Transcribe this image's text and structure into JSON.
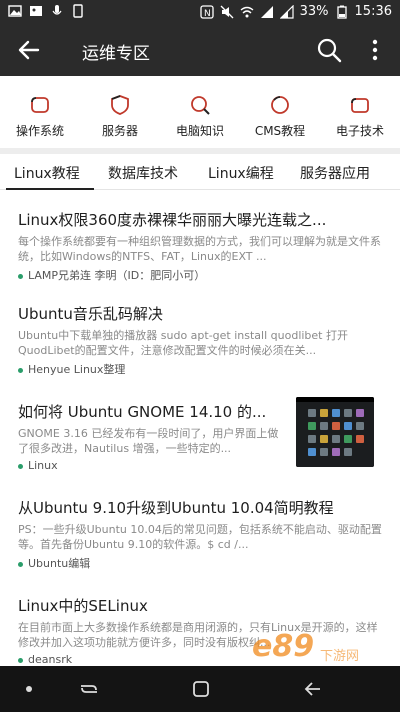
{
  "status_bar": {
    "battery": "33%",
    "time": "15:36"
  },
  "app_bar": {
    "title": "运维专区"
  },
  "categories": [
    {
      "label": "操作系统",
      "icon": "os-icon"
    },
    {
      "label": "服务器",
      "icon": "server-icon"
    },
    {
      "label": "电脑知识",
      "icon": "computer-knowledge-icon"
    },
    {
      "label": "CMS教程",
      "icon": "cms-icon"
    },
    {
      "label": "电子技术",
      "icon": "electronics-icon"
    }
  ],
  "tabs": [
    {
      "label": "Linux教程",
      "selected": true
    },
    {
      "label": "数据库技术",
      "selected": false
    },
    {
      "label": "Linux编程",
      "selected": false
    },
    {
      "label": "服务器应用",
      "selected": false
    }
  ],
  "articles": [
    {
      "title": "Linux权限360度赤裸裸华丽丽大曝光连载之...",
      "summary": "每个操作系统都要有一种组织管理数据的方式，我们可以理解为就是文件系统，比如Windows的NTFS、FAT，Linux的EXT ...",
      "author": "LAMP兄弟连 李明（ID：肥同小可）"
    },
    {
      "title": "Ubuntu音乐乱码解决",
      "summary": "Ubuntu中下载单独的播放器 sudo apt-get install quodlibet 打开QuodLibet的配置文件，注意修改配置文件的时候必须在关...",
      "author": "Henyue Linux整理"
    },
    {
      "title": "如何将 Ubuntu GNOME 14.10 的...",
      "summary": "GNOME 3.16 已经发布有一段时间了，用户界面上做了很多改进，Nautilus 增强，一些特定的...",
      "author": "Linux",
      "has_thumbnail": true
    },
    {
      "title": "从Ubuntu 9.10升级到Ubuntu 10.04简明教程",
      "summary": "PS：一些升级Ubuntu 10.04后的常见问题，包括系统不能启动、驱动配置等。首先备份Ubuntu 9.10的软件源。$ cd /...",
      "author": "Ubuntu编辑"
    },
    {
      "title": "Linux中的SELinux",
      "summary": "在目前市面上大多数操作系统都是商用闭源的，只有Linux是开源的，这样修改并加入这项功能就方便许多，同时没有版权纠...",
      "author": "deansrk"
    }
  ],
  "watermark": {
    "text": "e89",
    "subtext": "下游网"
  },
  "colors": {
    "bar_bg": "#2b2b2b",
    "accent_dot": "#2a9d6a",
    "category_icon": "#c0392b",
    "nav_bg": "#141414",
    "watermark_orange": "#f08a1c"
  }
}
